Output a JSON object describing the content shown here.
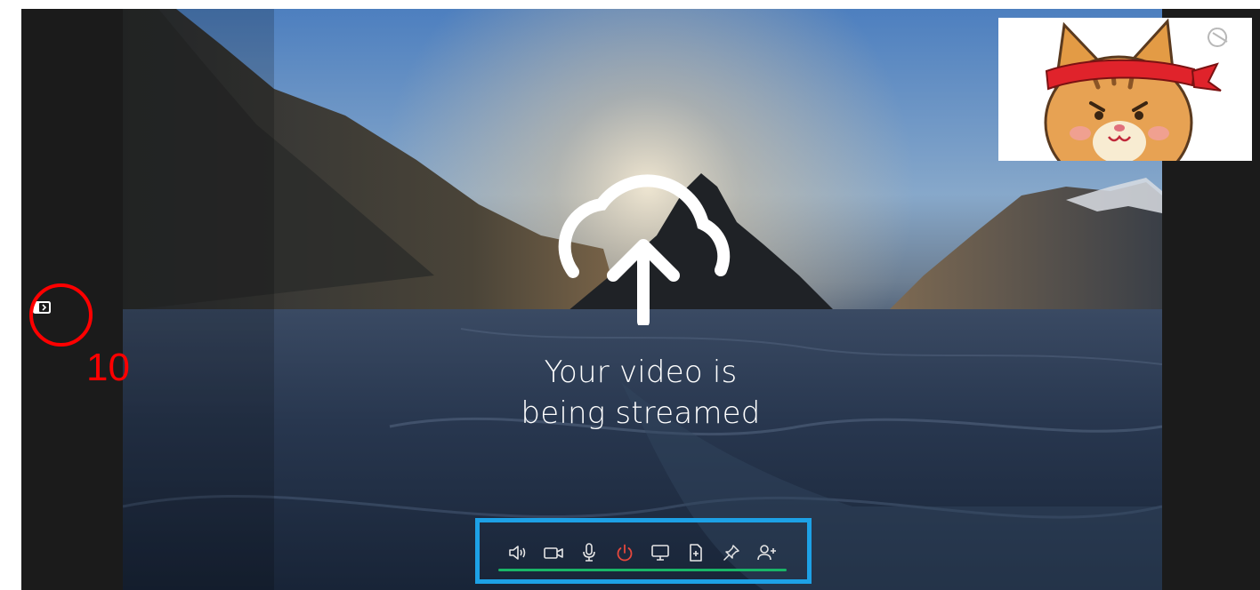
{
  "main": {
    "status_line1": "Your video is",
    "status_line2": "being streamed"
  },
  "annotation": {
    "number": "10",
    "ring_color": "#ff0000",
    "frame_color": "#1da1e6"
  },
  "toolbar": {
    "accent_underline": "#19b567",
    "leave_color": "#e5483d",
    "buttons": [
      {
        "icon": "speaker-icon"
      },
      {
        "icon": "camera-icon"
      },
      {
        "icon": "microphone-icon"
      },
      {
        "icon": "power-icon"
      },
      {
        "icon": "monitor-icon"
      },
      {
        "icon": "document-add-icon"
      },
      {
        "icon": "pin-icon"
      },
      {
        "icon": "add-user-icon"
      }
    ]
  },
  "sidebar": {
    "toggle_icon": "sidebar-expand-icon"
  }
}
